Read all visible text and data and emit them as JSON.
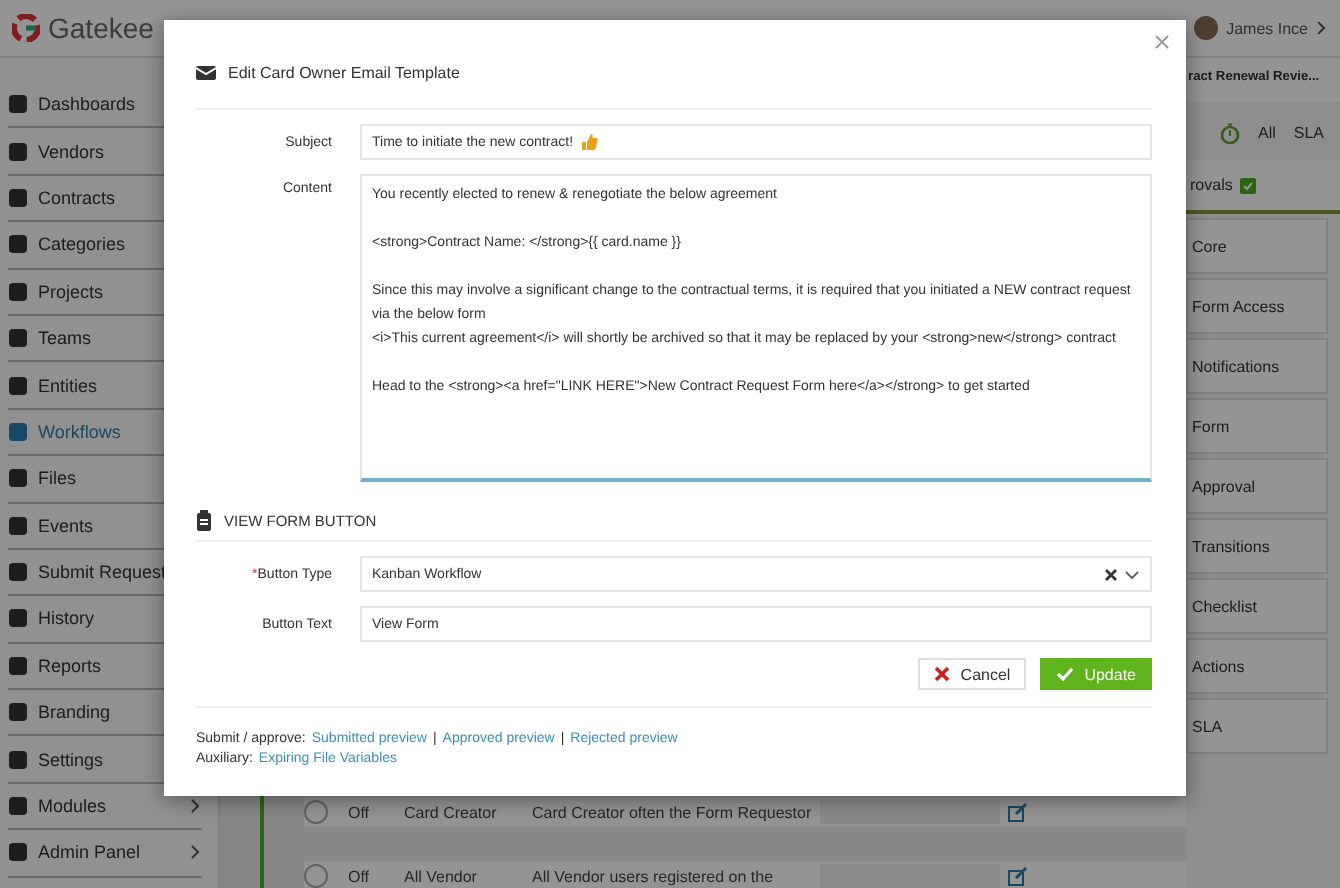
{
  "topbar": {
    "logo": "Gatekee",
    "user": "James Ince"
  },
  "sidebar": {
    "items": [
      {
        "label": "Dashboards",
        "selected": false
      },
      {
        "label": "Vendors",
        "selected": false
      },
      {
        "label": "Contracts",
        "selected": false
      },
      {
        "label": "Categories",
        "selected": false
      },
      {
        "label": "Projects",
        "selected": false
      },
      {
        "label": "Teams",
        "selected": false
      },
      {
        "label": "Entities",
        "selected": false
      },
      {
        "label": "Workflows",
        "selected": true
      },
      {
        "label": "Files",
        "selected": false
      },
      {
        "label": "Events",
        "selected": false
      },
      {
        "label": "Submit Request",
        "selected": false
      },
      {
        "label": "History",
        "selected": false
      },
      {
        "label": "Reports",
        "selected": false
      },
      {
        "label": "Branding",
        "selected": false
      },
      {
        "label": "Settings",
        "selected": false
      },
      {
        "label": "Modules",
        "selected": false,
        "submenu": true
      },
      {
        "label": "Admin Panel",
        "selected": false,
        "submenu": true
      }
    ]
  },
  "right_panel": {
    "title": "ract Renewal Revie...",
    "filters": [
      {
        "label": "All"
      },
      {
        "label": "SLA"
      }
    ],
    "section": "rovals",
    "section_done": true,
    "items": [
      "Core",
      "Form Access",
      "Notifications",
      "Form",
      "Approval",
      "Transitions",
      "Checklist",
      "Actions",
      "SLA"
    ]
  },
  "rows": [
    {
      "selected": false,
      "status": "Off",
      "role": "Card Creator",
      "description": "Card Creator often the Form Requestor"
    },
    {
      "selected": false,
      "status": "Off",
      "role": "All Vendor",
      "description": "All Vendor users registered on the"
    }
  ],
  "modal": {
    "title": "Edit Card Owner Email Template",
    "subject": {
      "label": "Subject",
      "value": "Time to initiate the new contract!"
    },
    "content": {
      "label": "Content",
      "paragraphs": [
        [
          "You recently elected to renew & renegotiate the below agreement"
        ],
        [
          "<strong>Contract Name: </strong>{{ card.name }}"
        ],
        [
          "Since this may involve a significant change to the contractual terms, it is required that you initiated a NEW contract request via the below form",
          "<i>This current agreement</i> will shortly be archived so that it may be replaced by your <strong>new</strong> contract"
        ],
        [
          "Head to the <strong><a href=\"LINK HERE\">New Contract Request Form here</a></strong> to get started"
        ]
      ]
    },
    "section": "VIEW FORM BUTTON",
    "button_type": {
      "label": "Button Type",
      "required": true,
      "required_mark": "*",
      "value": "Kanban Workflow"
    },
    "button_text": {
      "label": "Button Text",
      "value": "View Form"
    },
    "buttons": [
      {
        "kind": "cancel",
        "label": "Cancel"
      },
      {
        "kind": "update",
        "label": "Update"
      }
    ],
    "footer": [
      {
        "label": "Submit / approve:",
        "links": [
          "Submitted preview",
          "|",
          "Approved preview",
          "|",
          "Rejected preview"
        ]
      },
      {
        "label": "Auxiliary:",
        "links": [
          "Expiring File Variables"
        ]
      }
    ]
  }
}
